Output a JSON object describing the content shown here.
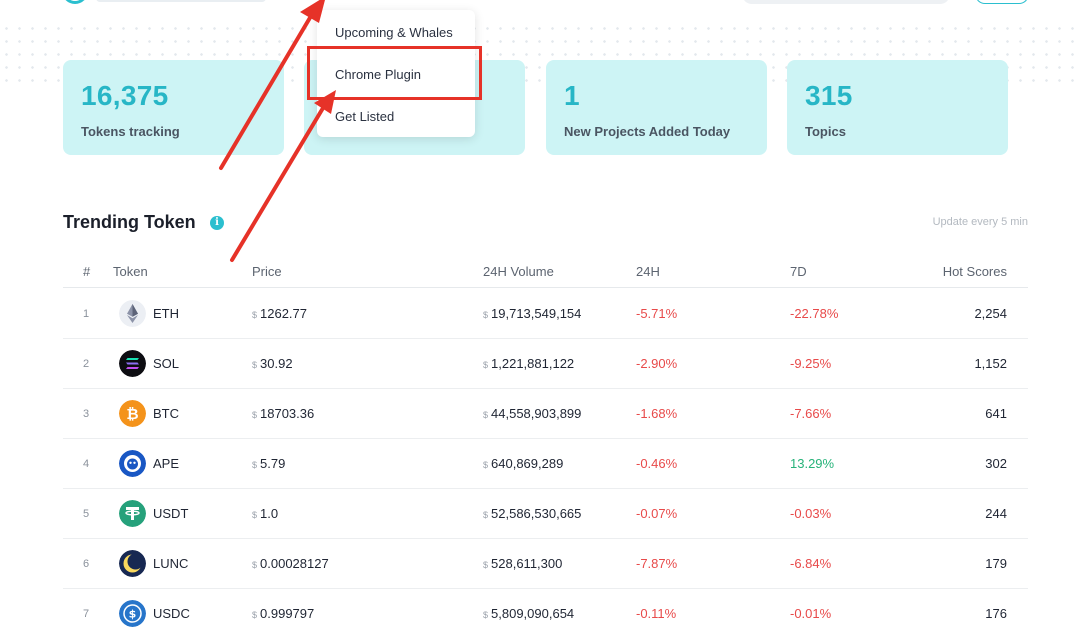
{
  "menu": {
    "items": [
      "Upcoming & Whales",
      "Chrome Plugin",
      "Get Listed"
    ]
  },
  "stats": [
    {
      "value": "16,375",
      "label": "Tokens tracking"
    },
    {
      "value": "",
      "label": ""
    },
    {
      "value": "1",
      "label": "New Projects Added Today"
    },
    {
      "value": "315",
      "label": "Topics"
    }
  ],
  "section": {
    "title": "Trending Token",
    "info_icon": "i",
    "update_note": "Update every 5 min"
  },
  "table": {
    "headers": [
      "#",
      "Token",
      "Price",
      "24H Volume",
      "24H",
      "7D",
      "Hot Scores"
    ],
    "currency_symbol": "$",
    "rows": [
      {
        "rank": "1",
        "symbol": "ETH",
        "price": "1262.77",
        "volume": "19,713,549,154",
        "change_24h": "-5.71%",
        "change_7d": "-22.78%",
        "hot": "2,254",
        "icon": "eth-icon"
      },
      {
        "rank": "2",
        "symbol": "SOL",
        "price": "30.92",
        "volume": "1,221,881,122",
        "change_24h": "-2.90%",
        "change_7d": "-9.25%",
        "hot": "1,152",
        "icon": "sol-icon"
      },
      {
        "rank": "3",
        "symbol": "BTC",
        "price": "18703.36",
        "volume": "44,558,903,899",
        "change_24h": "-1.68%",
        "change_7d": "-7.66%",
        "hot": "641",
        "icon": "btc-icon"
      },
      {
        "rank": "4",
        "symbol": "APE",
        "price": "5.79",
        "volume": "640,869,289",
        "change_24h": "-0.46%",
        "change_7d": "13.29%",
        "hot": "302",
        "icon": "ape-icon"
      },
      {
        "rank": "5",
        "symbol": "USDT",
        "price": "1.0",
        "volume": "52,586,530,665",
        "change_24h": "-0.07%",
        "change_7d": "-0.03%",
        "hot": "244",
        "icon": "usdt-icon"
      },
      {
        "rank": "6",
        "symbol": "LUNC",
        "price": "0.00028127",
        "volume": "528,611,300",
        "change_24h": "-7.87%",
        "change_7d": "-6.84%",
        "hot": "179",
        "icon": "lunc-icon"
      },
      {
        "rank": "7",
        "symbol": "USDC",
        "price": "0.999797",
        "volume": "5,809,090,654",
        "change_24h": "-0.11%",
        "change_7d": "-0.01%",
        "hot": "176",
        "icon": "usdc-icon"
      }
    ]
  },
  "colors": {
    "accent": "#27b6c6",
    "card_bg": "#cdf4f5",
    "negative": "#e84a4a",
    "positive": "#27b37a",
    "annotation": "#e63228"
  }
}
